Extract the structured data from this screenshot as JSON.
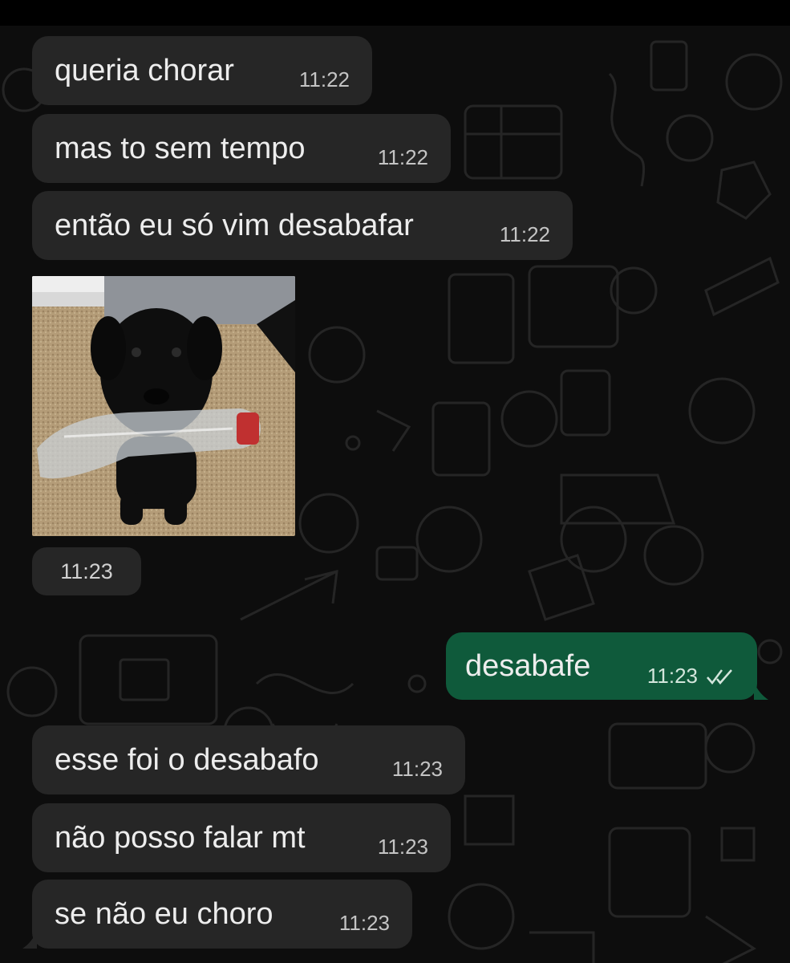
{
  "messages": [
    {
      "text": "queria chorar",
      "time": "11:22"
    },
    {
      "text": "mas to sem tempo",
      "time": "11:22"
    },
    {
      "text": "então eu só vim desabafar",
      "time": "11:22"
    },
    {
      "time": "11:23"
    },
    {
      "text": "desabafe",
      "time": "11:23"
    },
    {
      "text": "esse foi o desabafo",
      "time": "11:23"
    },
    {
      "text": "não posso falar mt",
      "time": "11:23"
    },
    {
      "text": "se não eu choro",
      "time": "11:23"
    }
  ],
  "colors": {
    "incoming_bubble": "#262626",
    "outgoing_bubble": "#0f5a3b",
    "background": "#0d0d0d"
  },
  "icons": {
    "read_receipt": "double-check-icon"
  }
}
